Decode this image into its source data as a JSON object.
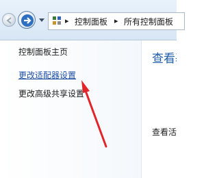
{
  "breadcrumbs": [
    "控制面板",
    "所有控制面板"
  ],
  "sidebar": {
    "items": [
      {
        "label": "控制面板主页"
      },
      {
        "label": "更改适配器设置"
      },
      {
        "label": "更改高级共享设置"
      }
    ]
  },
  "main": {
    "title": "查看基",
    "text": "查看活"
  },
  "colors": {
    "link": "#1e4fa3",
    "title": "#1f5ca8",
    "arrow": "#e0262b"
  },
  "icons": [
    "back-icon",
    "forward-icon",
    "chevron-down-icon",
    "control-panel-icon",
    "chevron-right-icon"
  ]
}
